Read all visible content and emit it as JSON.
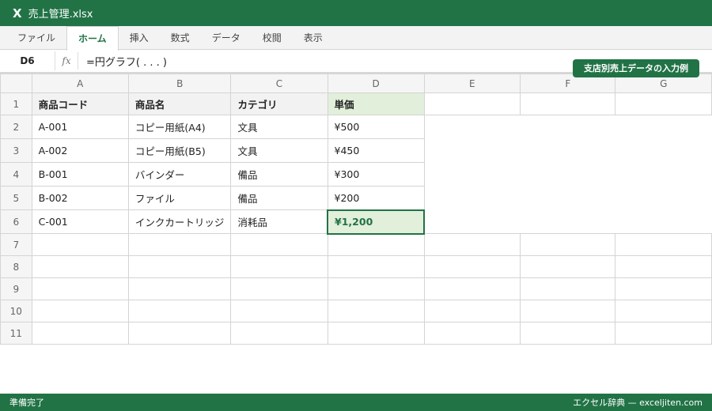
{
  "title": {
    "icon": "X",
    "filename": "売上管理.xlsx"
  },
  "ribbon": {
    "tabs": [
      "ファイル",
      "ホーム",
      "挿入",
      "数式",
      "データ",
      "校閲",
      "表示"
    ],
    "active": "ホーム"
  },
  "formula_bar": {
    "cell": "D6",
    "fx": "fx",
    "formula": "=円グラフ( . . . )"
  },
  "badge": "支店別売上データの入力例",
  "sheet": {
    "columns": [
      "A",
      "B",
      "C",
      "D",
      "E",
      "F",
      "G"
    ],
    "rows": [
      "1",
      "2",
      "3",
      "4",
      "5",
      "6",
      "7",
      "8",
      "9",
      "10",
      "11"
    ],
    "header": [
      "商品コード",
      "商品名",
      "カテゴリ",
      "単価"
    ],
    "data": [
      [
        "A-001",
        "コピー用紙(A4)",
        "文具",
        "¥500"
      ],
      [
        "A-002",
        "コピー用紙(B5)",
        "文具",
        "¥450"
      ],
      [
        "B-001",
        "バインダー",
        "備品",
        "¥300"
      ],
      [
        "B-002",
        "ファイル",
        "備品",
        "¥200"
      ],
      [
        "C-001",
        "インクカートリッジ",
        "消耗品",
        "¥1,200"
      ]
    ],
    "selected_cell": "D6"
  },
  "status": {
    "left": "準備完了",
    "right": "エクセル辞典 — exceljiten.com"
  },
  "colors": {
    "accent": "#217346",
    "selection_fill": "#e2efda"
  }
}
